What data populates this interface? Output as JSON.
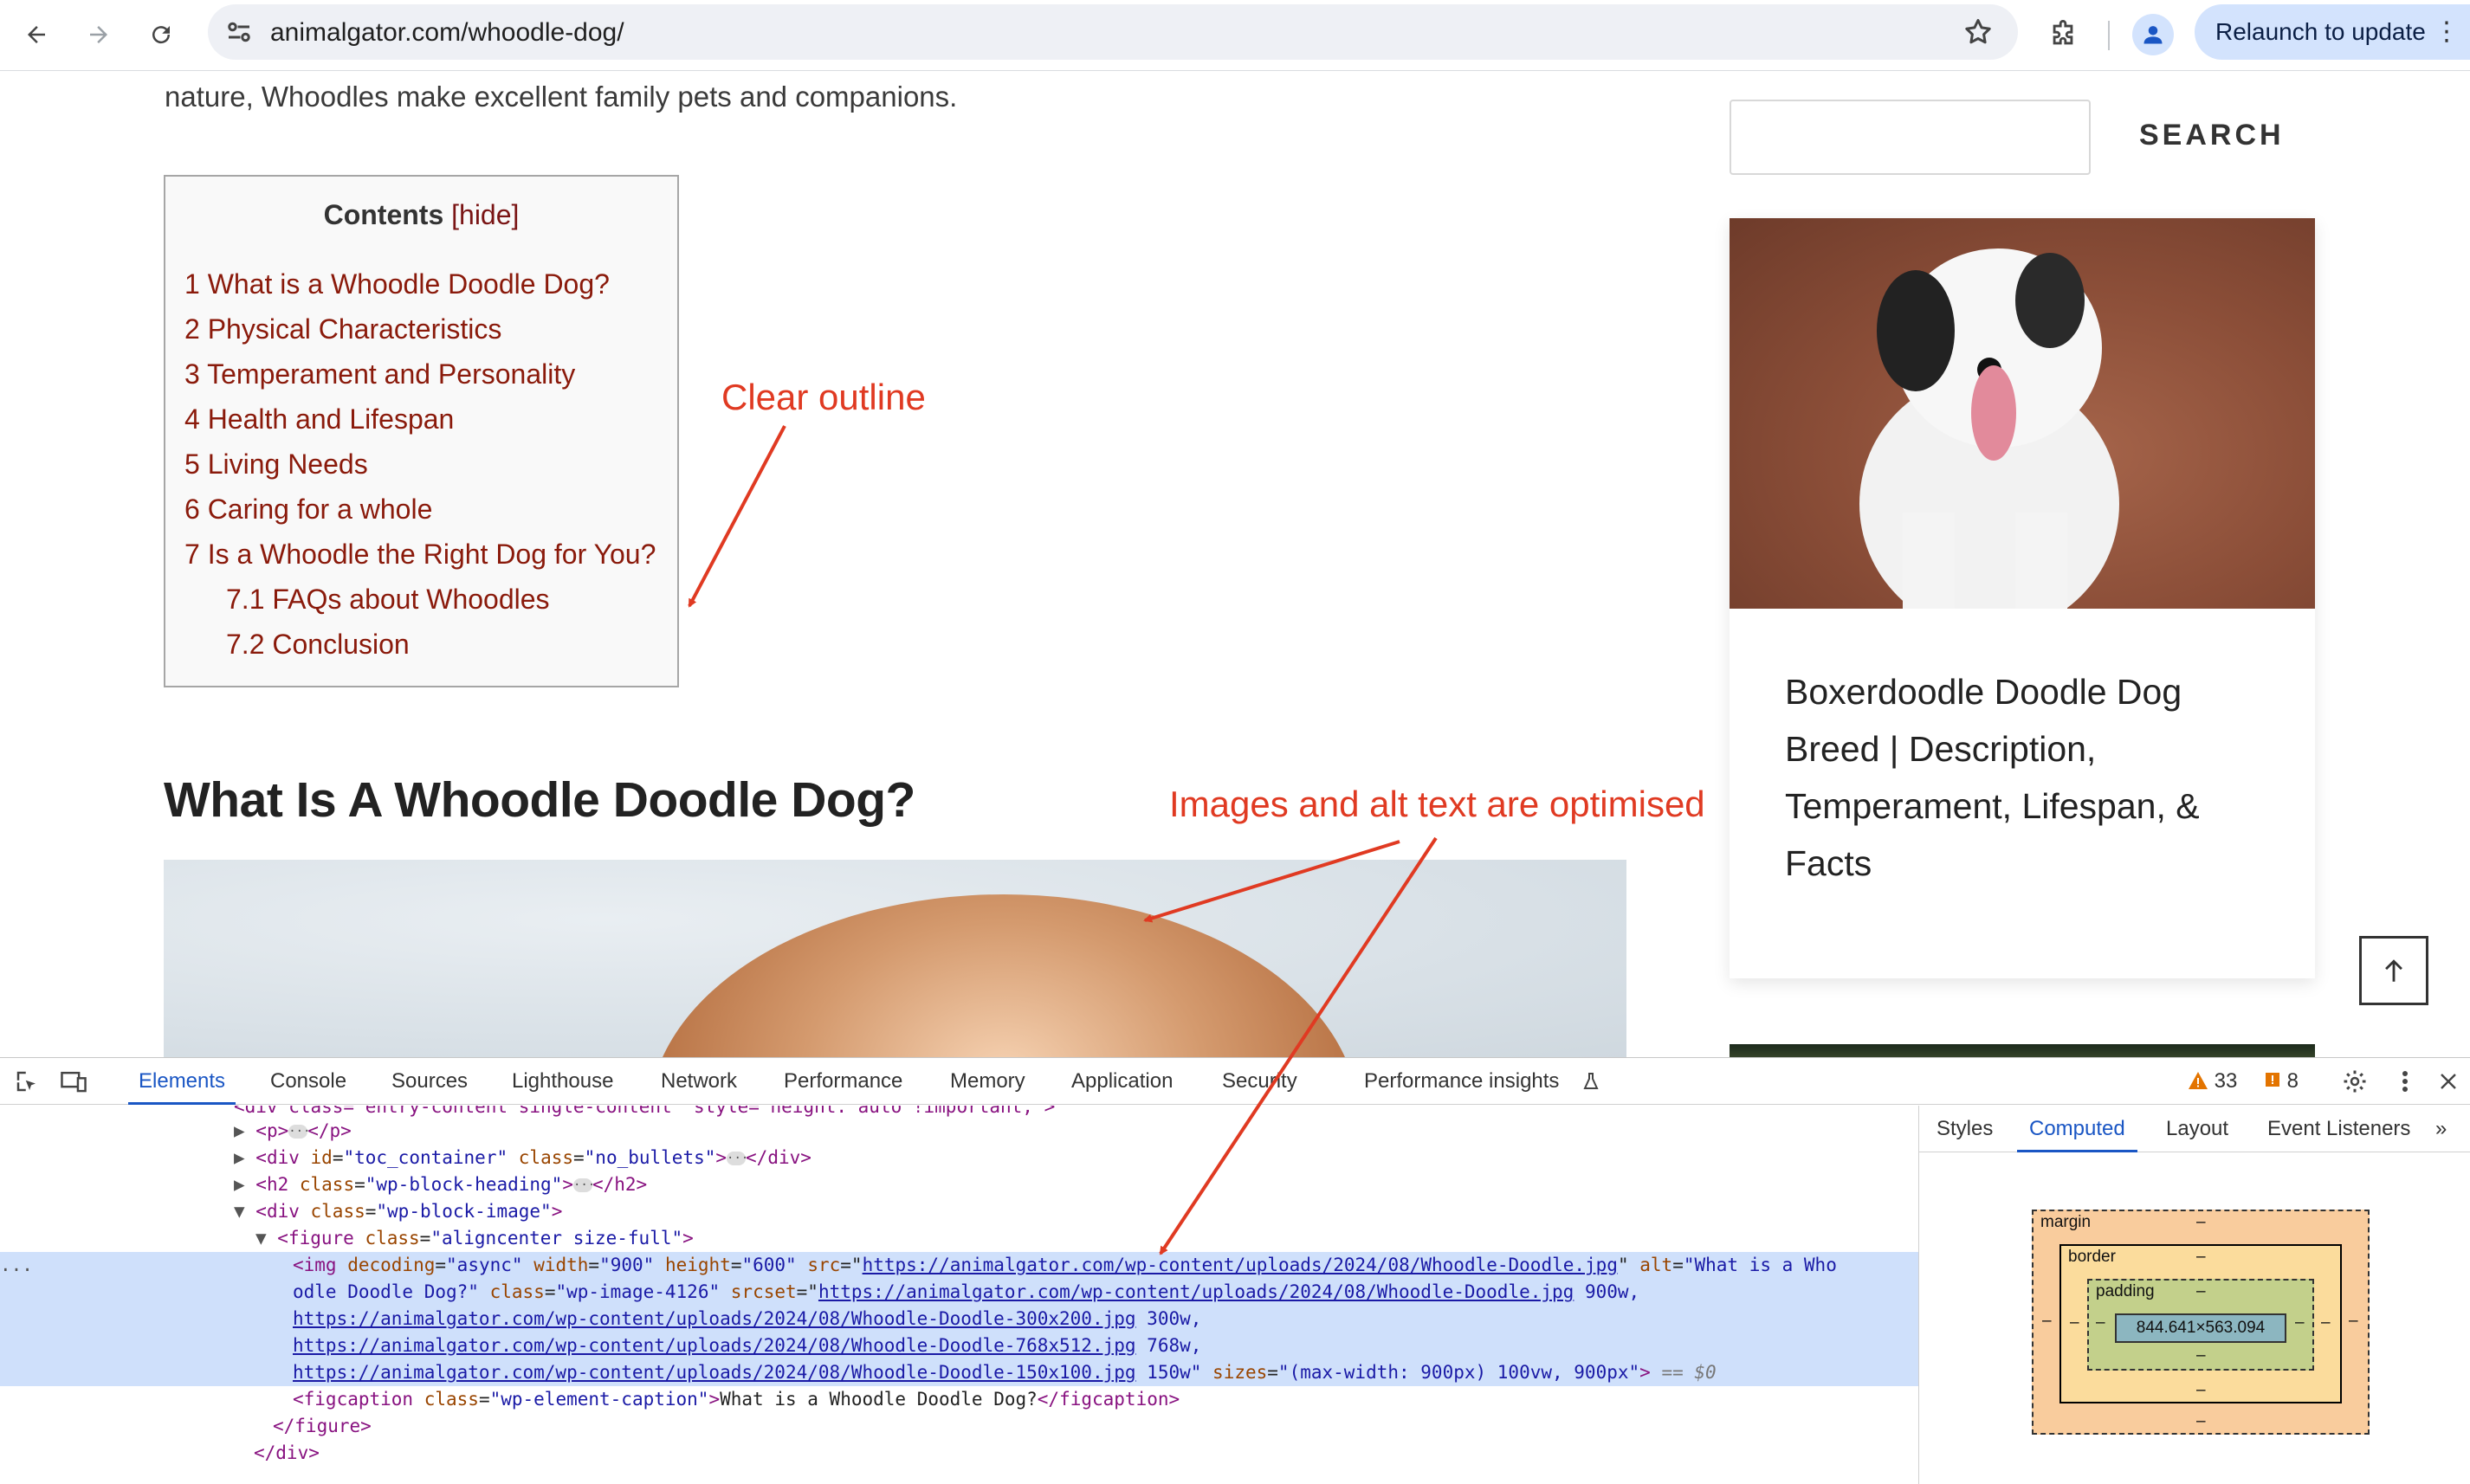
{
  "browser": {
    "url": "animalgator.com/whoodle-dog/",
    "relaunch_label": "Relaunch to update",
    "relaunch_menu": "⋮"
  },
  "page": {
    "intro_text": "nature, Whoodles make excellent family pets and companions.",
    "toc": {
      "title": "Contents",
      "hide_label": "[hide]",
      "items": [
        {
          "label": "1 What is a Whoodle Doodle Dog?"
        },
        {
          "label": "2 Physical Characteristics"
        },
        {
          "label": "3 Temperament and Personality"
        },
        {
          "label": "4 Health and Lifespan"
        },
        {
          "label": "5 Living Needs"
        },
        {
          "label": "6 Caring for a whole"
        },
        {
          "label": "7 Is a Whoodle the Right Dog for You?"
        },
        {
          "label": "7.1 FAQs about Whoodles"
        },
        {
          "label": "7.2 Conclusion"
        }
      ]
    },
    "heading": "What Is A Whoodle Doodle Dog?",
    "search_button": "SEARCH",
    "card_title": "Boxerdoodle Doodle Dog Breed | Description, Temperament, Lifespan, & Facts",
    "annotations": {
      "clear_outline": "Clear outline",
      "images_alt": "Images and alt text are optimised"
    },
    "accent_color": "#e03a22",
    "link_color": "#8a1a0b"
  },
  "devtools": {
    "tabs": [
      "Elements",
      "Console",
      "Sources",
      "Lighthouse",
      "Network",
      "Performance",
      "Memory",
      "Application",
      "Security",
      "Performance insights"
    ],
    "active_tab": "Elements",
    "warnings_count": "33",
    "issues_count": "8",
    "side_tabs": [
      "Styles",
      "Computed",
      "Layout",
      "Event Listeners"
    ],
    "side_more": "»",
    "active_side_tab": "Computed",
    "dom": {
      "line0": "<div class=\"entry-content single-content\" style=\"height: auto !important;\">",
      "p_open": "<p>",
      "p_close": "</p>",
      "div_toc_open": "<div ",
      "id_attr": "id",
      "id_val": "\"toc_container\"",
      "class_attr": "class",
      "toc_class_val": "\"no_bullets\"",
      "div_close": "</div>",
      "h2_open": "<h2 ",
      "h2_class_val": "\"wp-block-heading\"",
      "h2_close": "</h2>",
      "div_img_open": "<div ",
      "div_img_class_val": "\"wp-block-image\"",
      "figure_open": "<figure ",
      "figure_class_val": "\"aligncenter size-full\"",
      "img_tag": "<img ",
      "img_attrs_a": "decoding",
      "img_val_a": "\"async\"",
      "img_attrs_b": "width",
      "img_val_b": "\"900\"",
      "img_attrs_c": "height",
      "img_val_c": "\"600\"",
      "img_attrs_d": "src",
      "img_src": "https://animalgator.com/wp-content/uploads/2024/08/Whoodle-Doodle.jpg",
      "img_attrs_e": "alt",
      "img_alt_1": "\"What is a Who",
      "img_alt_2": "odle Doodle Dog?\"",
      "img_class_val": "\"wp-image-4126\"",
      "srcset_attr": "srcset",
      "srcset_1": "https://animalgator.com/wp-content/uploads/2024/08/Whoodle-Doodle.jpg",
      "srcset_1_w": " 900w,",
      "srcset_2": "https://animalgator.com/wp-content/uploads/2024/08/Whoodle-Doodle-300x200.jpg",
      "srcset_2_w": " 300w,",
      "srcset_3": "https://animalgator.com/wp-content/uploads/2024/08/Whoodle-Doodle-768x512.jpg",
      "srcset_3_w": " 768w,",
      "srcset_4": "https://animalgator.com/wp-content/uploads/2024/08/Whoodle-Doodle-150x100.jpg",
      "srcset_4_w": " 150w\"",
      "sizes_attr": "sizes",
      "sizes_val": "\"(max-width: 900px) 100vw, 900px\"",
      "sizes_close": ">",
      "sel_marker": " == $0",
      "figcaption_open": "<figcaption ",
      "figcaption_class_val": "\"wp-element-caption\"",
      "figcaption_text": "What is a Whoodle Doodle Dog?",
      "figcaption_close": "</figcaption>",
      "figure_close": "</figure>",
      "gutter_dots": "..."
    },
    "box_model": {
      "margin_label": "margin",
      "border_label": "border",
      "padding_label": "padding",
      "dash": "–",
      "content_size": "844.641×563.094"
    }
  }
}
